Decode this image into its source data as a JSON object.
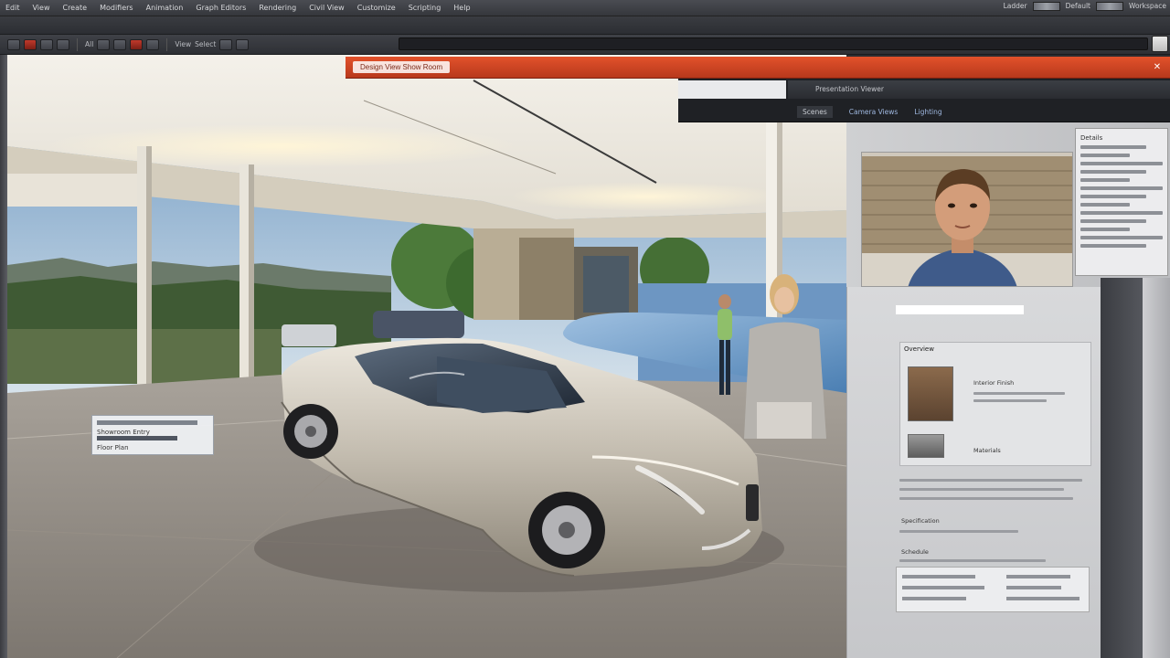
{
  "menubar": {
    "items": [
      "Edit",
      "View",
      "Create",
      "Modifiers",
      "Animation",
      "Graph Editors",
      "Rendering",
      "Civil View",
      "Customize",
      "Scripting",
      "Help"
    ],
    "right_items": [
      "Ladder",
      "Default",
      "Workspace"
    ]
  },
  "toolbar": {
    "labels": [
      "All",
      "View",
      "Select"
    ]
  },
  "floating_window": {
    "tab_label": "Design View Show Room",
    "close_icon": "close-icon"
  },
  "panel_header": {
    "title": "Presentation Viewer",
    "tabs": [
      "Scenes",
      "Camera Views",
      "Lighting"
    ]
  },
  "info_card": {
    "title": "Details"
  },
  "doc_panel": {
    "section_title": "Overview",
    "item_1": "Interior Finish",
    "item_2": "Materials",
    "row_a": "Specification",
    "row_b": "Schedule"
  },
  "viewport": {
    "label_title": "Showroom Entry",
    "label_sub": "Floor Plan"
  },
  "colors": {
    "accent_orange": "#d94a25",
    "panel_dark": "#1f2125",
    "car_silver": "#c9c2b4"
  }
}
